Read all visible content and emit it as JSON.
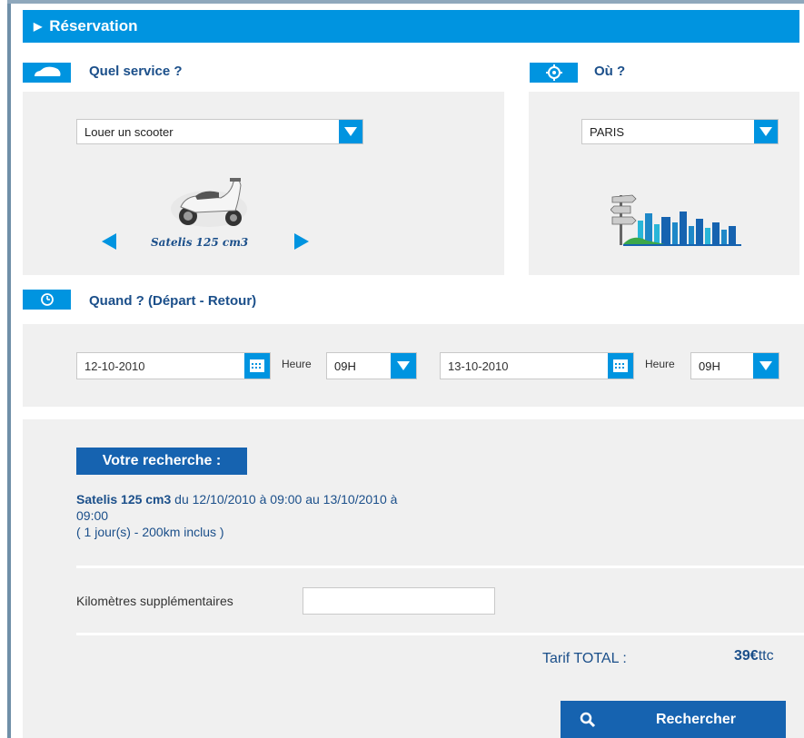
{
  "header": {
    "title": "Réservation"
  },
  "service": {
    "label": "Quel service ?",
    "selected": "Louer un scooter",
    "model_name": "Satelis 125 cm3"
  },
  "location": {
    "label": "Où ?",
    "selected": "PARIS"
  },
  "when": {
    "label": "Quand ? (Départ - Retour)",
    "depart_date": "12-10-2010",
    "depart_heure_label": "Heure",
    "depart_heure": "09H",
    "retour_date": "13-10-2010",
    "retour_heure_label": "Heure",
    "retour_heure": "09H"
  },
  "search": {
    "title": "Votre recherche :",
    "model": "Satelis 125 cm3",
    "dates_line1": " du 12/10/2010 à 09:00 au 13/10/2010 à",
    "dates_line2": "09:00",
    "details": "( 1 jour(s) - 200km inclus )"
  },
  "extra_km": {
    "label": "Kilomètres supplémentaires",
    "value": ""
  },
  "total": {
    "label": "Tarif TOTAL :",
    "amount": "39€",
    "suffix": "ttc"
  },
  "button": {
    "label": "Rechercher"
  },
  "colors": {
    "accent": "#0094e0",
    "dark_blue": "#1663b0",
    "panel": "#f0f0f0",
    "text_blue": "#1b4f8a"
  },
  "icons": {
    "service": "car-icon",
    "location": "crosshair-icon",
    "when": "clock-icon",
    "calendar": "calendar-icon",
    "search": "magnifier-icon"
  }
}
